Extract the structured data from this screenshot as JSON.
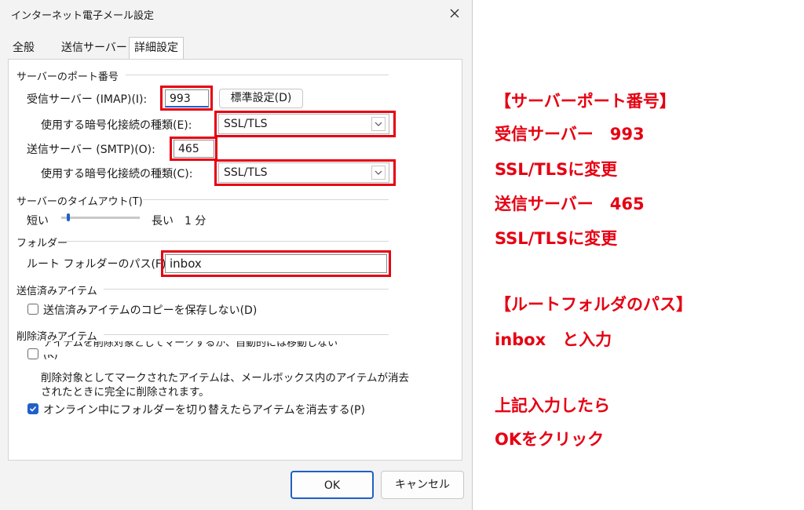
{
  "dialog": {
    "title": "インターネット電子メール設定",
    "tabs": [
      "全般",
      "送信サーバー",
      "詳細設定"
    ],
    "server_ports": {
      "section": "サーバーのポート番号",
      "incoming_label": "受信サーバー (IMAP)(I):",
      "incoming_value": "993",
      "default_button": "標準設定(D)",
      "incoming_enc_label": "使用する暗号化接続の種類(E):",
      "incoming_enc_value": "SSL/TLS",
      "outgoing_label": "送信サーバー (SMTP)(O):",
      "outgoing_value": "465",
      "outgoing_enc_label": "使用する暗号化接続の種類(C):",
      "outgoing_enc_value": "SSL/TLS"
    },
    "timeout": {
      "section": "サーバーのタイムアウト(T)",
      "short": "短い",
      "long": "長い",
      "value": "1 分"
    },
    "folders": {
      "section": "フォルダー",
      "root_label": "ルート フォルダーのパス(F):",
      "root_value": "inbox"
    },
    "sent_items": {
      "section": "送信済みアイテム",
      "no_copy": "送信済みアイテムのコピーを保存しない(D)"
    },
    "deleted_items": {
      "section": "削除済みアイテム",
      "mark_line1": "アイテムを削除対象としてマークするが、自動的には移動しない",
      "mark_line2": "(K)",
      "desc1": "削除対象としてマークされたアイテムは、メールボックス内のアイテムが消去",
      "desc2": "されたときに完全に削除されます。",
      "purge": "オンライン中にフォルダーを切り替えたらアイテムを消去する(P)"
    },
    "ok": "OK",
    "cancel": "キャンセル"
  },
  "annotations": {
    "l1": "【サーバーポート番号】",
    "l2": "受信サーバー　993",
    "l3": "SSL/TLSに変更",
    "l4": "送信サーバー　465",
    "l5": "SSL/TLSに変更",
    "l6": "【ルートフォルダのパス】",
    "l7": "inbox　と入力",
    "l8": "上記入力したら",
    "l9": "OKをクリック"
  },
  "colors": {
    "highlight": "#e60012",
    "accent": "#1f5fc9"
  }
}
